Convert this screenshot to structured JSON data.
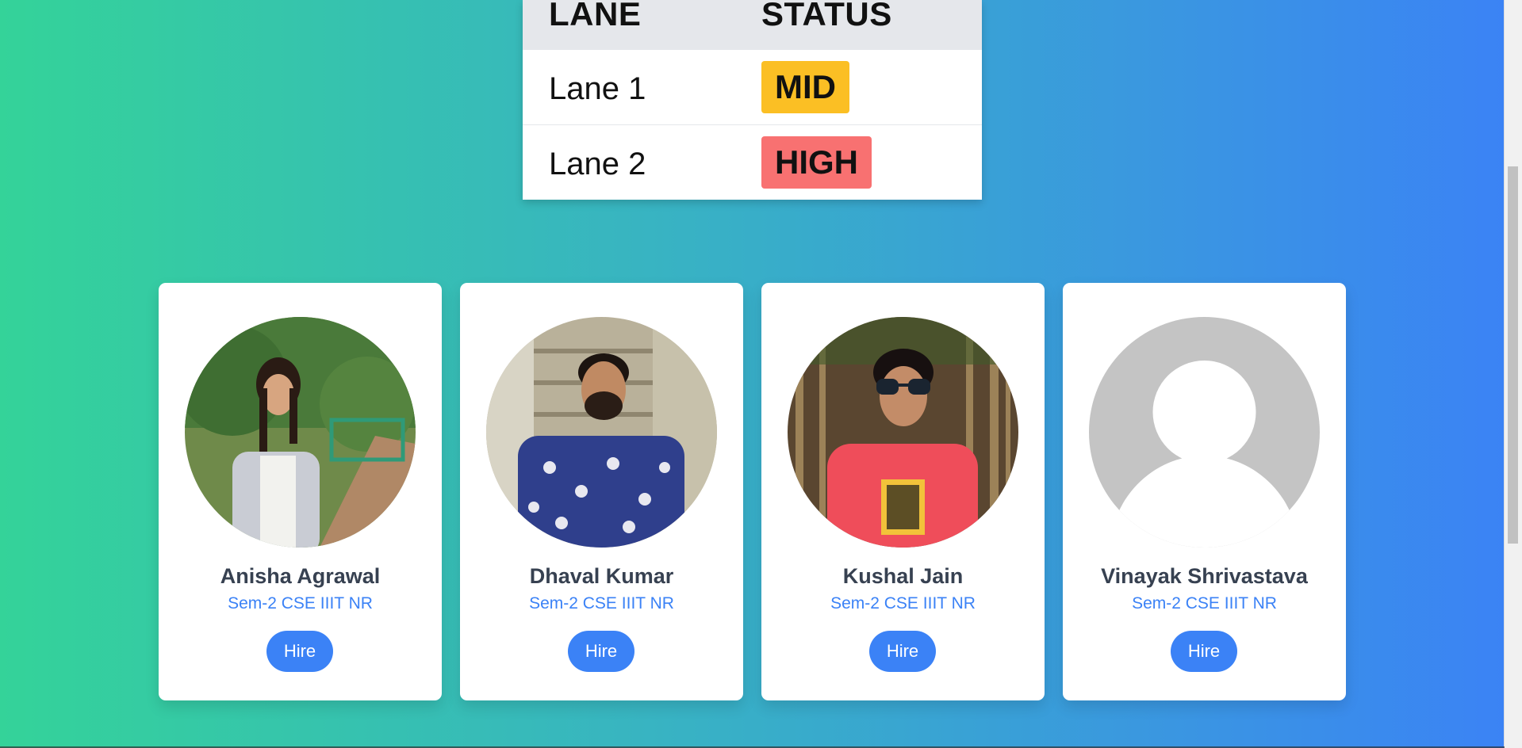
{
  "lane_table": {
    "headers": {
      "lane": "LANE",
      "status": "STATUS"
    },
    "rows": [
      {
        "lane": "Lane 1",
        "status": "MID",
        "status_color": "#fbbf24"
      },
      {
        "lane": "Lane 2",
        "status": "HIGH",
        "status_color": "#f87171"
      }
    ]
  },
  "team": [
    {
      "name": "Anisha Agrawal",
      "subtitle": "Sem-2 CSE IIIT NR",
      "button": "Hire"
    },
    {
      "name": "Dhaval Kumar",
      "subtitle": "Sem-2 CSE IIIT NR",
      "button": "Hire"
    },
    {
      "name": "Kushal Jain",
      "subtitle": "Sem-2 CSE IIIT NR",
      "button": "Hire"
    },
    {
      "name": "Vinayak Shrivastava",
      "subtitle": "Sem-2 CSE IIIT NR",
      "button": "Hire"
    }
  ],
  "colors": {
    "accent": "#3b82f6",
    "gradient_start": "#34d399",
    "gradient_end": "#3b82f6"
  }
}
